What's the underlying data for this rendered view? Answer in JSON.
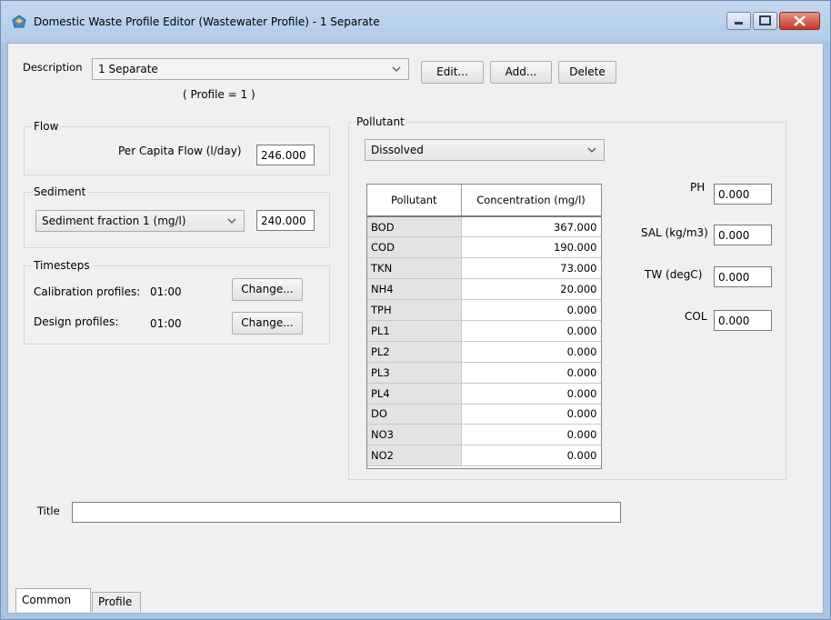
{
  "window": {
    "title": "Domestic Waste Profile Editor (Wastewater Profile) - 1 Separate"
  },
  "description": {
    "label": "Description",
    "value": "1 Separate",
    "profile_note": "( Profile = 1 )",
    "buttons": {
      "edit": "Edit...",
      "add": "Add...",
      "delete": "Delete"
    }
  },
  "flow": {
    "group_label": "Flow",
    "per_capita_label": "Per Capita Flow (l/day)",
    "per_capita_value": "246.000"
  },
  "sediment": {
    "group_label": "Sediment",
    "fraction_select": "Sediment fraction 1 (mg/l)",
    "value": "240.000"
  },
  "timesteps": {
    "group_label": "Timesteps",
    "calibration_label": "Calibration profiles:",
    "calibration_value": "01:00",
    "design_label": "Design profiles:",
    "design_value": "01:00",
    "change_label": "Change..."
  },
  "pollutant": {
    "group_label": "Pollutant",
    "type_select": "Dissolved",
    "columns": [
      "Pollutant",
      "Concentration (mg/l)"
    ],
    "rows": [
      {
        "name": "BOD",
        "value": "367.000"
      },
      {
        "name": "COD",
        "value": "190.000"
      },
      {
        "name": "TKN",
        "value": "73.000"
      },
      {
        "name": "NH4",
        "value": "20.000"
      },
      {
        "name": "TPH",
        "value": "0.000"
      },
      {
        "name": "PL1",
        "value": "0.000"
      },
      {
        "name": "PL2",
        "value": "0.000"
      },
      {
        "name": "PL3",
        "value": "0.000"
      },
      {
        "name": "PL4",
        "value": "0.000"
      },
      {
        "name": "DO",
        "value": "0.000"
      },
      {
        "name": "NO3",
        "value": "0.000"
      },
      {
        "name": "NO2",
        "value": "0.000"
      }
    ]
  },
  "params": {
    "ph": {
      "label": "PH",
      "value": "0.000"
    },
    "sal": {
      "label": "SAL (kg/m3)",
      "value": "0.000"
    },
    "tw": {
      "label": "TW (degC)",
      "value": "0.000"
    },
    "col": {
      "label": "COL",
      "value": "0.000"
    }
  },
  "title_field": {
    "label": "Title",
    "value": ""
  },
  "tabs": [
    "Common",
    "Profile"
  ],
  "colors": {
    "accent_close": "#c1392b",
    "titlebar": "#b9d1ea"
  }
}
